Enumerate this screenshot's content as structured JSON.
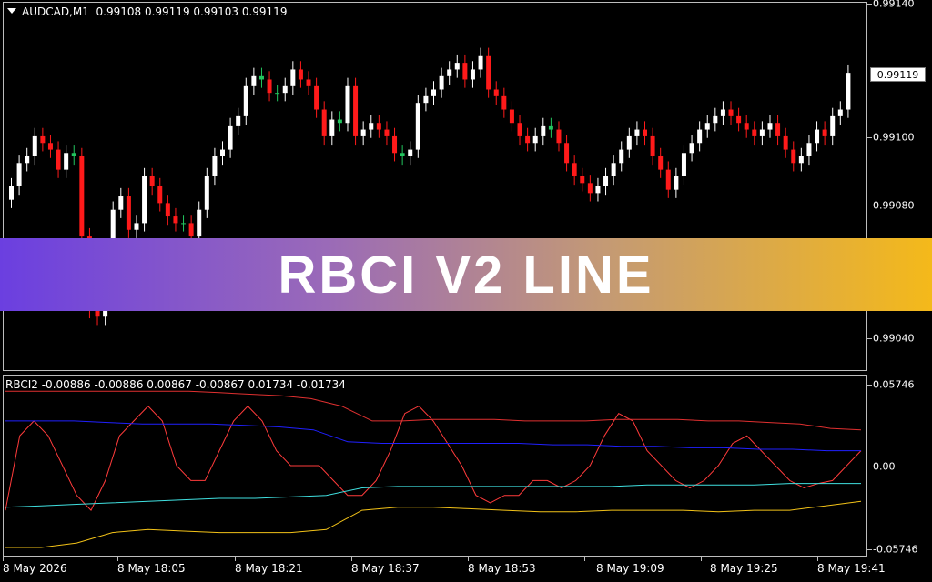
{
  "chart_header": {
    "symbol": "AUDCAD,M1",
    "ohlc": "0.99108 0.99119 0.99103 0.99119"
  },
  "price_axis": {
    "labels": [
      "0.99140",
      "0.99100",
      "0.99080",
      "0.99040"
    ],
    "current_price": "0.99119"
  },
  "indicator": {
    "title": "RBCI2 -0.00886 -0.00886 0.00867 -0.00867 0.01734 -0.01734",
    "axis_labels": [
      "0.05746",
      "0.00",
      "-0.05746"
    ]
  },
  "time_axis": {
    "labels": [
      "8 May 2026",
      "8 May 18:05",
      "8 May 18:21",
      "8 May 18:37",
      "8 May 18:53",
      "8 May 19:09",
      "8 May 19:25",
      "8 May 19:41"
    ]
  },
  "banner": {
    "text": "RBCI V2 LINE"
  },
  "colors": {
    "bull_candle": "#ffffff",
    "bear_candle": "#ff1a1a",
    "doji": "#22c55e",
    "rbci_line": "#ff3b3b",
    "upper_band": "#e03030",
    "mid_upper": "#2020ff",
    "mid_lower": "#40e0e0",
    "lower_band": "#f2c218",
    "banner_start": "#6b3fe0",
    "banner_end": "#f4b91a"
  },
  "chart_data": [
    {
      "type": "candlestick",
      "title": "AUDCAD,M1",
      "ylim": [
        0.9903,
        0.9914
      ],
      "close_series": [
        0.99085,
        0.99092,
        0.99094,
        0.991,
        0.99098,
        0.99096,
        0.9909,
        0.99095,
        0.99094,
        0.9907,
        0.99048,
        0.99046,
        0.9906,
        0.99078,
        0.99082,
        0.99072,
        0.99074,
        0.99088,
        0.99085,
        0.9908,
        0.99076,
        0.99074,
        0.99074,
        0.9907,
        0.99078,
        0.99088,
        0.99094,
        0.99096,
        0.99103,
        0.99106,
        0.99115,
        0.99118,
        0.99117,
        0.99113,
        0.99113,
        0.99115,
        0.9912,
        0.99117,
        0.99115,
        0.99108,
        0.991,
        0.99105,
        0.99104,
        0.99115,
        0.991,
        0.99102,
        0.99104,
        0.99102,
        0.991,
        0.99095,
        0.99094,
        0.99096,
        0.9911,
        0.99112,
        0.99114,
        0.99118,
        0.9912,
        0.99122,
        0.99117,
        0.9912,
        0.99124,
        0.99114,
        0.99112,
        0.99108,
        0.99104,
        0.991,
        0.99098,
        0.991,
        0.99103,
        0.99102,
        0.99098,
        0.99092,
        0.99088,
        0.99086,
        0.99083,
        0.99085,
        0.99088,
        0.99092,
        0.99096,
        0.991,
        0.99102,
        0.991,
        0.99094,
        0.9909,
        0.99084,
        0.99088,
        0.99095,
        0.99098,
        0.99102,
        0.99104,
        0.99106,
        0.99108,
        0.99106,
        0.99104,
        0.99102,
        0.991,
        0.99102,
        0.99104,
        0.991,
        0.99096,
        0.99092,
        0.99094,
        0.99098,
        0.99102,
        0.991,
        0.99106,
        0.99108,
        0.99119
      ]
    },
    {
      "type": "line",
      "title": "RBCI2",
      "ylim": [
        -0.05746,
        0.05746
      ],
      "series": [
        {
          "name": "RBCI",
          "values": [
            -0.03,
            0.02,
            0.03,
            0.02,
            0.0,
            -0.02,
            -0.03,
            -0.01,
            0.02,
            0.03,
            0.04,
            0.03,
            0.0,
            -0.01,
            -0.01,
            0.01,
            0.03,
            0.04,
            0.03,
            0.01,
            0.0,
            0.0,
            0.0,
            -0.01,
            -0.02,
            -0.02,
            -0.01,
            0.01,
            0.035,
            0.04,
            0.03,
            0.015,
            0.0,
            -0.02,
            -0.025,
            -0.02,
            -0.02,
            -0.01,
            -0.01,
            -0.015,
            -0.01,
            0.0,
            0.02,
            0.035,
            0.03,
            0.01,
            0.0,
            -0.01,
            -0.015,
            -0.01,
            0.0,
            0.015,
            0.02,
            0.01,
            0.0,
            -0.01,
            -0.015,
            -0.012,
            -0.01,
            0.0,
            0.01
          ]
        },
        {
          "name": "UpperBand",
          "values": [
            0.05,
            0.05,
            0.05,
            0.05,
            0.05,
            0.05,
            0.05,
            0.049,
            0.048,
            0.047,
            0.045,
            0.04,
            0.03,
            0.03,
            0.031,
            0.031,
            0.031,
            0.03,
            0.03,
            0.03,
            0.031,
            0.031,
            0.031,
            0.03,
            0.03,
            0.029,
            0.028,
            0.025,
            0.024
          ]
        },
        {
          "name": "MidUpper",
          "values": [
            0.03,
            0.03,
            0.03,
            0.029,
            0.028,
            0.028,
            0.028,
            0.027,
            0.026,
            0.024,
            0.016,
            0.015,
            0.015,
            0.015,
            0.015,
            0.015,
            0.014,
            0.014,
            0.013,
            0.013,
            0.012,
            0.012,
            0.011,
            0.011,
            0.01,
            0.01
          ]
        },
        {
          "name": "MidLower",
          "values": [
            -0.028,
            -0.027,
            -0.026,
            -0.025,
            -0.024,
            -0.023,
            -0.022,
            -0.022,
            -0.021,
            -0.02,
            -0.015,
            -0.014,
            -0.014,
            -0.014,
            -0.014,
            -0.014,
            -0.014,
            -0.014,
            -0.013,
            -0.013,
            -0.013,
            -0.013,
            -0.012,
            -0.012,
            -0.012
          ]
        },
        {
          "name": "LowerBand",
          "values": [
            -0.055,
            -0.055,
            -0.052,
            -0.045,
            -0.043,
            -0.044,
            -0.045,
            -0.045,
            -0.045,
            -0.043,
            -0.03,
            -0.028,
            -0.028,
            -0.029,
            -0.03,
            -0.031,
            -0.031,
            -0.03,
            -0.03,
            -0.03,
            -0.031,
            -0.03,
            -0.03,
            -0.027,
            -0.024
          ]
        }
      ]
    }
  ]
}
